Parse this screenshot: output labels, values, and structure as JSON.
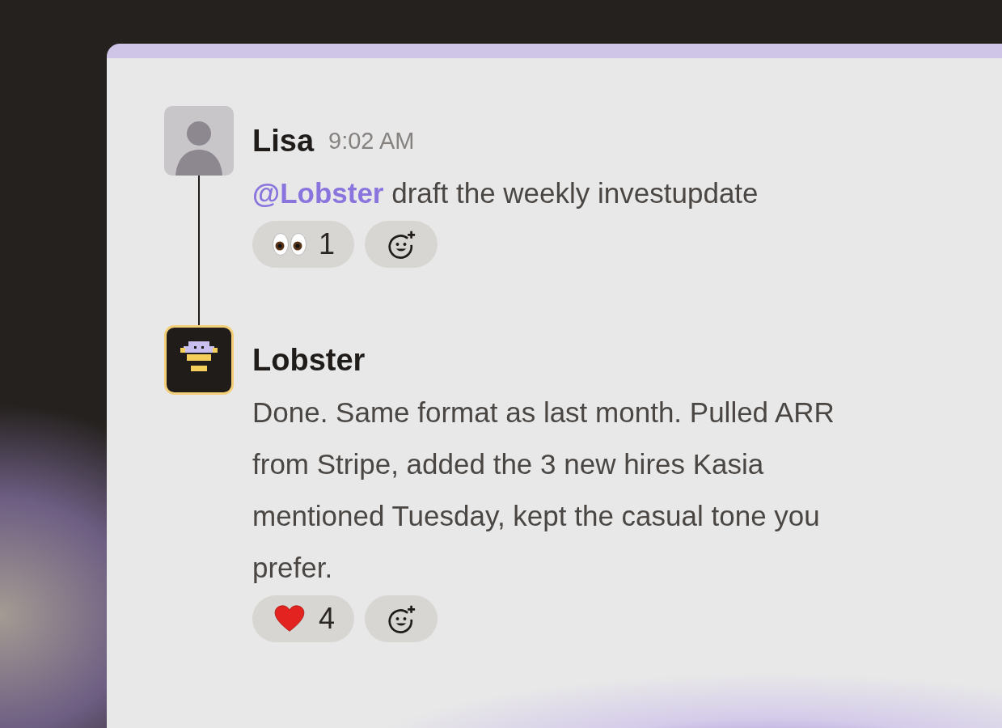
{
  "messages": [
    {
      "author": "Lisa",
      "kind": "human",
      "time": "9:02 AM",
      "text": "**@Lobster** draft the weekly investupdate",
      "reactions": [
        {
          "kind": "eyes",
          "count": "1"
        }
      ]
    },
    {
      "author": "Lobster",
      "kind": "bot",
      "text": "Done. Same format as last month. Pulled ARR from Stripe, added the 3 new hires Kasia mentioned Tuesday, kept the casual tone you prefer.",
      "reactions": [
        {
          "kind": "heart",
          "count": "4"
        }
      ]
    }
  ]
}
